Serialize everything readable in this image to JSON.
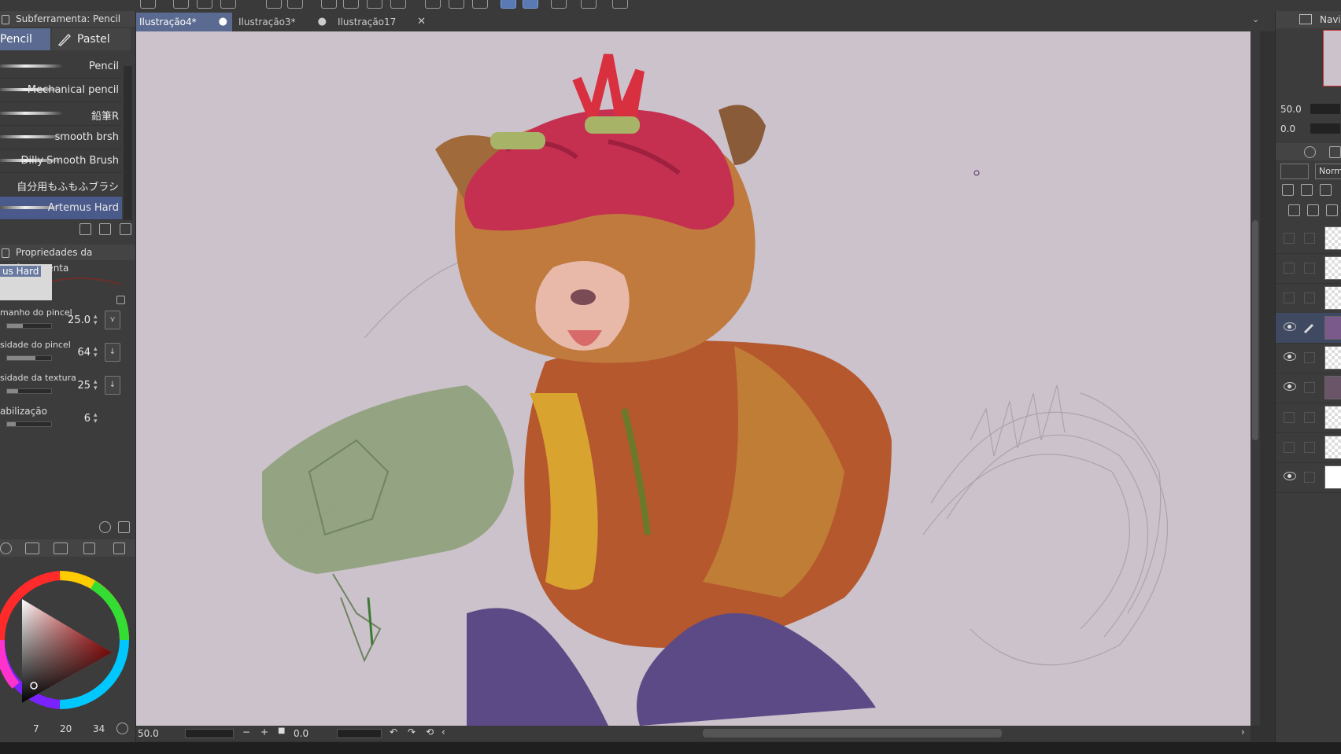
{
  "tool_subpanel": {
    "title": "Subferramenta: Pencil"
  },
  "subtabs": [
    {
      "label": "Pencil"
    },
    {
      "label": "Pastel"
    }
  ],
  "brushes": [
    {
      "label": "Pencil"
    },
    {
      "label": "Mechanical pencil"
    },
    {
      "label": "鉛筆R"
    },
    {
      "label": "smooth brsh"
    },
    {
      "label": "Dilly Smooth Brush"
    },
    {
      "label": "自分用もふもふブラシ"
    },
    {
      "label": "Artemus Hard"
    }
  ],
  "tool_props": {
    "title": "Propriedades da ferramenta",
    "preset_name": "us Hard",
    "rows": [
      {
        "label": "manho do pincel",
        "value": "25.0",
        "level": 0.35
      },
      {
        "label": "sidade do pincel",
        "value": "64",
        "level": 0.64
      },
      {
        "label": "sidade da textura",
        "value": "25",
        "level": 0.25
      },
      {
        "label": "abilização",
        "value": "6",
        "level": 0.2
      }
    ]
  },
  "color_counts": [
    "7",
    "20",
    "34"
  ],
  "doc_tabs": [
    {
      "name": "Ilustração4*",
      "active": true,
      "close": "●"
    },
    {
      "name": "Ilustração3*",
      "active": false,
      "close": "●"
    },
    {
      "name": "Ilustração17",
      "active": false,
      "close": "✕"
    }
  ],
  "status": {
    "zoom": "50.0",
    "rotation": "0.0"
  },
  "navigator": {
    "label": "Navi",
    "zoom": "50.0",
    "angle": "0.0"
  },
  "layers_panel": {
    "blend": "Norm"
  },
  "layers": [
    {
      "visible": false
    },
    {
      "visible": false
    },
    {
      "visible": false
    },
    {
      "visible": true,
      "editing": true
    },
    {
      "visible": true
    },
    {
      "visible": true
    },
    {
      "visible": false
    },
    {
      "visible": false
    },
    {
      "visible": true
    }
  ],
  "colors": {
    "accent": "#5b6a90",
    "canvas_bg": "#cbc2cc"
  }
}
